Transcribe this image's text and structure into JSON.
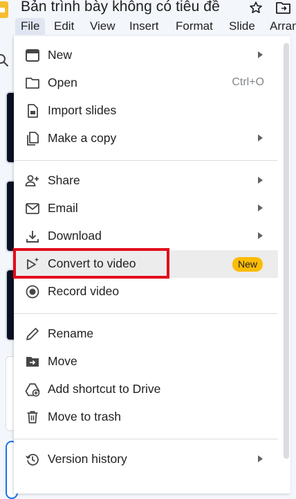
{
  "header": {
    "title": "Bản trình bày không có tiêu đề",
    "menus": [
      "File",
      "Edit",
      "View",
      "Insert",
      "Format",
      "Slide",
      "Arran"
    ]
  },
  "file_menu": {
    "items": [
      {
        "label": "New",
        "icon": "presentation-icon",
        "submenu": true
      },
      {
        "label": "Open",
        "icon": "folder-icon",
        "shortcut": "Ctrl+O"
      },
      {
        "label": "Import slides",
        "icon": "import-slides-icon"
      },
      {
        "label": "Make a copy",
        "icon": "copy-icon",
        "submenu": true
      },
      {
        "label": "Share",
        "icon": "person-add-icon",
        "submenu": true
      },
      {
        "label": "Email",
        "icon": "mail-icon",
        "submenu": true
      },
      {
        "label": "Download",
        "icon": "download-icon",
        "submenu": true
      },
      {
        "label": "Convert to video",
        "icon": "video-sparkle-icon",
        "badge": "New",
        "highlighted": true
      },
      {
        "label": "Record video",
        "icon": "record-icon"
      },
      {
        "label": "Rename",
        "icon": "pencil-icon"
      },
      {
        "label": "Move",
        "icon": "folder-move-icon"
      },
      {
        "label": "Add shortcut to Drive",
        "icon": "drive-shortcut-icon"
      },
      {
        "label": "Move to trash",
        "icon": "trash-icon"
      },
      {
        "label": "Version history",
        "icon": "history-icon",
        "submenu": true
      }
    ]
  },
  "colors": {
    "accent": "#1a73e8",
    "badge": "#fbbc04",
    "highlight_box": "#e3081a",
    "hover": "#ececec"
  }
}
